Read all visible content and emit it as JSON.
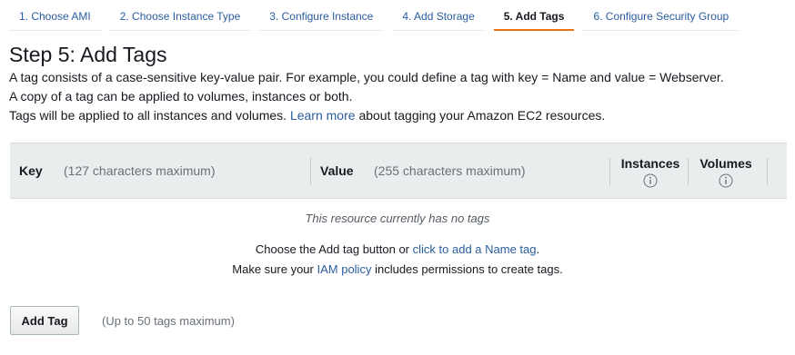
{
  "wizard": {
    "steps": [
      {
        "label": "1. Choose AMI"
      },
      {
        "label": "2. Choose Instance Type"
      },
      {
        "label": "3. Configure Instance"
      },
      {
        "label": "4. Add Storage"
      },
      {
        "label": "5. Add Tags",
        "active": true
      },
      {
        "label": "6. Configure Security Group"
      }
    ],
    "active_accent": "#ec7211"
  },
  "header": {
    "title": "Step 5: Add Tags"
  },
  "intro": {
    "line1": "A tag consists of a case-sensitive key-value pair. For example, you could define a tag with key = Name and value = Webserver.",
    "line2": "A copy of a tag can be applied to volumes, instances or both.",
    "line3_before": "Tags will be applied to all instances and volumes.",
    "line3_link": "Learn more",
    "line3_after": "about tagging your Amazon EC2 resources."
  },
  "table": {
    "key_label": "Key",
    "key_hint": "(127 characters maximum)",
    "value_label": "Value",
    "value_hint": "(255 characters maximum)",
    "instances_label": "Instances",
    "volumes_label": "Volumes",
    "info_icon": "info-circle-icon"
  },
  "empty_state": {
    "message": "This resource currently has no tags",
    "choose_before": "Choose the Add tag button or",
    "choose_link": "click to add a Name tag",
    "choose_after": ".",
    "policy_before": "Make sure your",
    "policy_link": "IAM policy",
    "policy_after": "includes permissions to create tags."
  },
  "footer": {
    "add_tag_label": "Add Tag",
    "limit_hint": "(Up to 50 tags maximum)"
  },
  "colors": {
    "link": "#2a5d9f",
    "table_header_bg": "#eaeded"
  }
}
